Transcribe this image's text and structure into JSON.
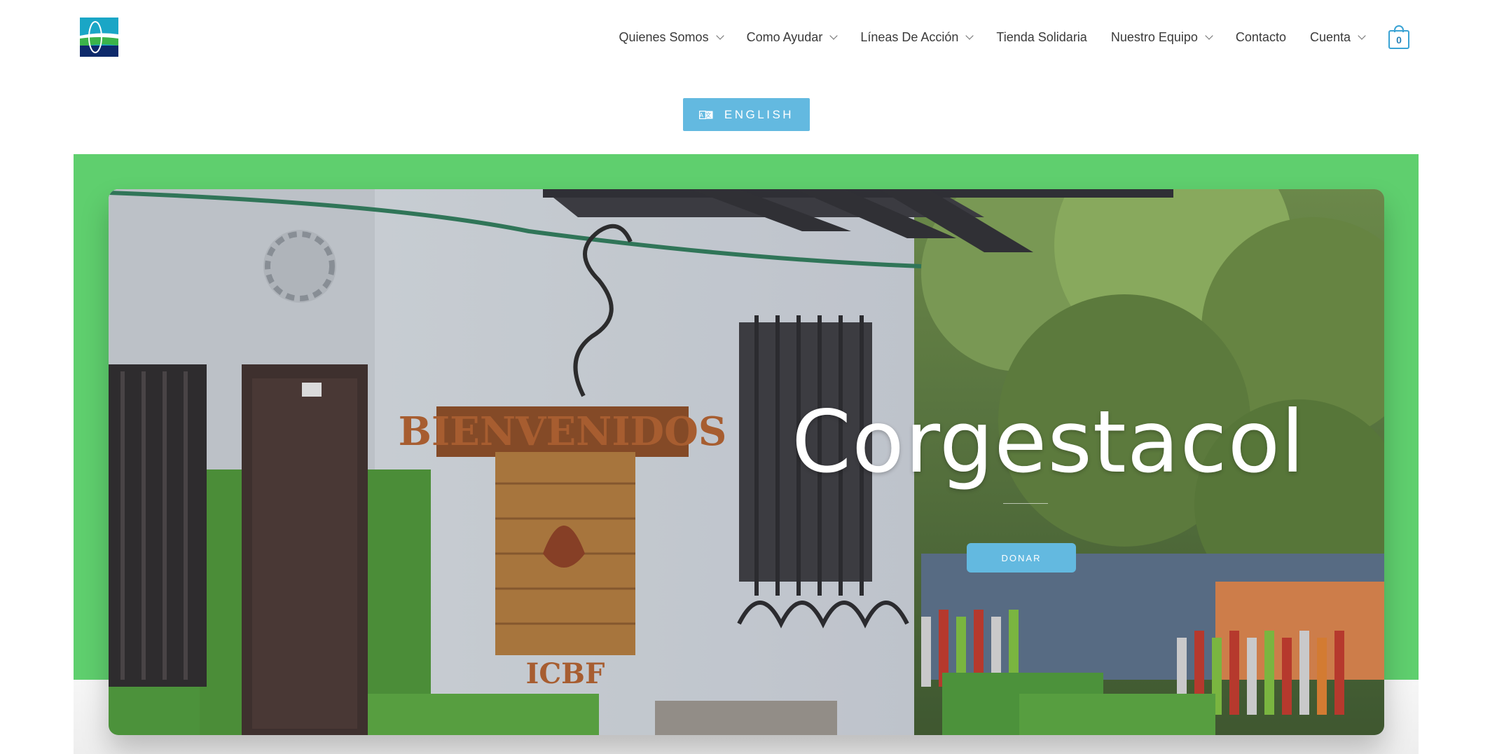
{
  "header": {
    "logo_icon": "corgestacol-logo",
    "nav": [
      {
        "label": "Quienes Somos",
        "has_dropdown": true
      },
      {
        "label": "Como Ayudar",
        "has_dropdown": true
      },
      {
        "label": "Líneas De Acción",
        "has_dropdown": true
      },
      {
        "label": "Tienda Solidaria",
        "has_dropdown": false
      },
      {
        "label": "Nuestro Equipo",
        "has_dropdown": true
      },
      {
        "label": "Contacto",
        "has_dropdown": false
      },
      {
        "label": "Cuenta",
        "has_dropdown": true
      }
    ],
    "cart": {
      "count": "0",
      "icon": "shopping-bag-icon"
    }
  },
  "language_button": {
    "label": "ENGLISH",
    "icon": "language-icon"
  },
  "hero": {
    "title": "Corgestacol",
    "cta_label": "DONAR",
    "sign_text": "BIENVENIDOS",
    "plaque_text": "ICBF"
  },
  "colors": {
    "accent_blue": "#63b9e0",
    "hero_band_green": "#5fcf6e",
    "text": "#3a3a3a"
  }
}
